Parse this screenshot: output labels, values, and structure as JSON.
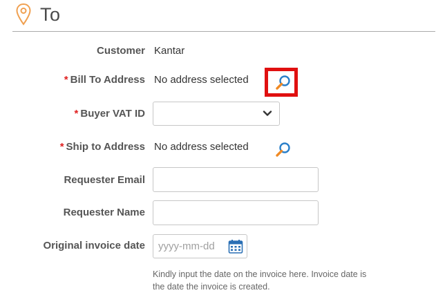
{
  "section": {
    "title": "To",
    "icon": "map-pin-icon"
  },
  "form": {
    "customer": {
      "label": "Customer",
      "value": "Kantar"
    },
    "bill_to": {
      "required_mark": "*",
      "label": "Bill To Address",
      "value": "No address selected",
      "icon": "search-icon"
    },
    "buyer_vat": {
      "required_mark": "*",
      "label": "Buyer VAT ID",
      "selected": ""
    },
    "ship_to": {
      "required_mark": "*",
      "label": "Ship to Address",
      "value": "No address selected",
      "icon": "search-icon"
    },
    "requester_email": {
      "label": "Requester Email",
      "value": ""
    },
    "requester_name": {
      "label": "Requester Name",
      "value": ""
    },
    "invoice_date": {
      "label": "Original invoice date",
      "placeholder": "yyyy-mm-dd",
      "icon": "calendar-icon"
    },
    "help_text": "Kindly input the date on the invoice here. Invoice date is the date the invoice is created."
  },
  "colors": {
    "highlight": "#e01010",
    "required": "#e02020",
    "pin": "#f0a050",
    "search_lens": "#2a7fc9",
    "search_handle": "#f08a24"
  }
}
